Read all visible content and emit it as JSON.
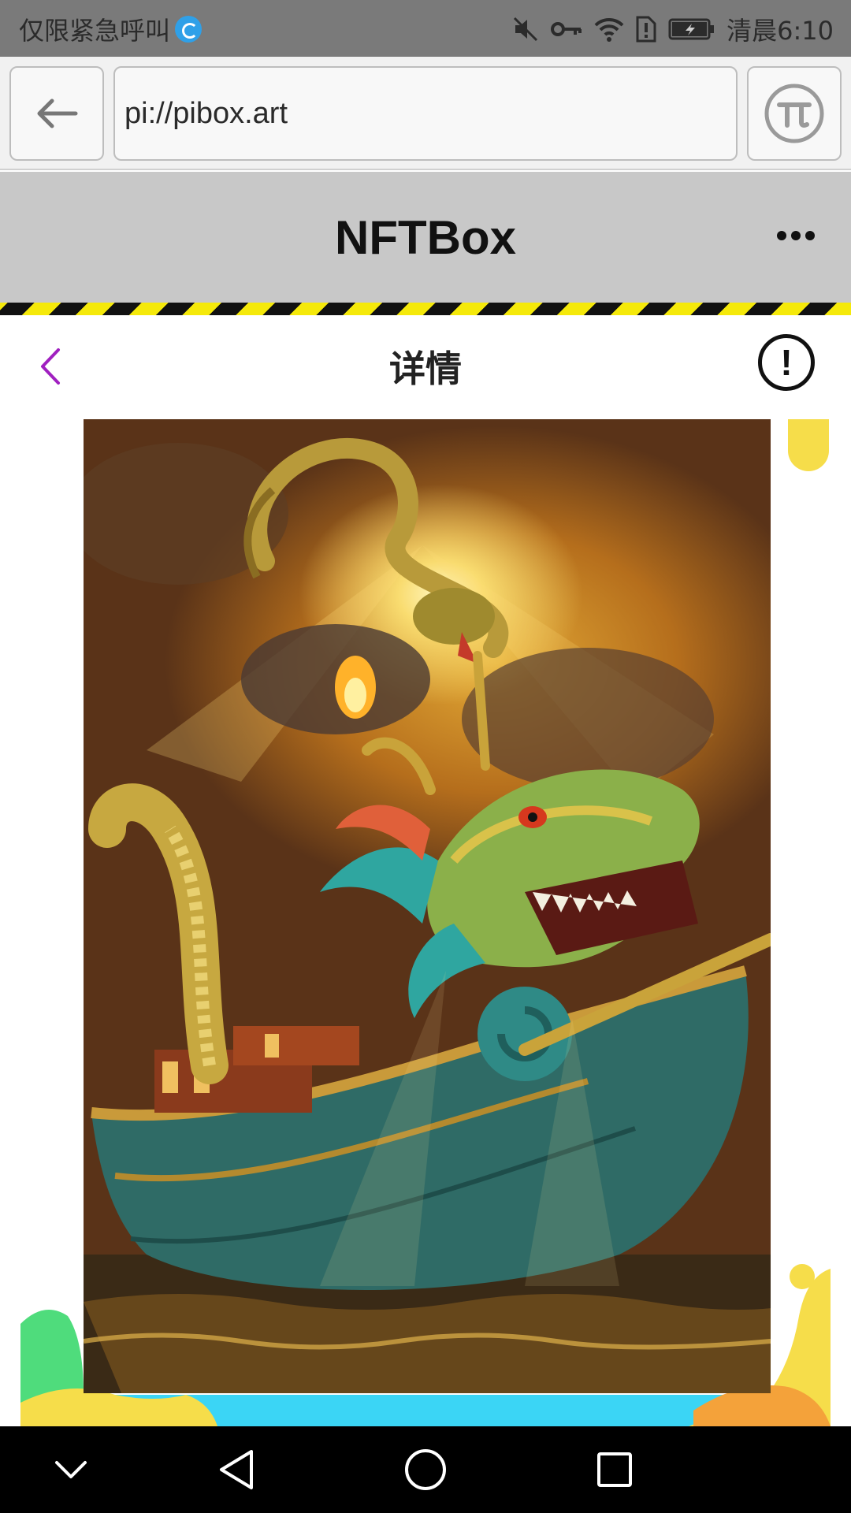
{
  "status_bar": {
    "left_text": "仅限紧急呼叫",
    "time": "清晨6:10",
    "icons": [
      "huawei-cloud-icon",
      "mute-icon",
      "vpn-key-icon",
      "wifi-icon",
      "sim-alert-icon",
      "battery-charging-icon"
    ]
  },
  "browser": {
    "url": "pi://pibox.art",
    "back_icon": "arrow-left-icon",
    "pi_icon": "pi-network-icon"
  },
  "app_header": {
    "title": "NFTBox",
    "more_icon": "more-horizontal-icon"
  },
  "detail": {
    "title": "详情",
    "back_icon": "chevron-left-icon",
    "info_icon": "info-icon",
    "info_glyph": "!"
  },
  "artwork": {
    "subject": "dragon-boat-artwork"
  },
  "nav_bar": {
    "icons": [
      "hide-keyboard-icon",
      "back-triangle-icon",
      "home-circle-icon",
      "recents-square-icon"
    ]
  },
  "colors": {
    "status_bar": "#7a7a7a",
    "header": "#c8c8c8",
    "stripe_yellow": "#f5e90a",
    "stripe_black": "#111111",
    "back_chevron": "#a020c0",
    "accent_cyan": "#3bd5f5",
    "accent_green": "#4fdc7c",
    "accent_yellow": "#f6dd4a"
  }
}
